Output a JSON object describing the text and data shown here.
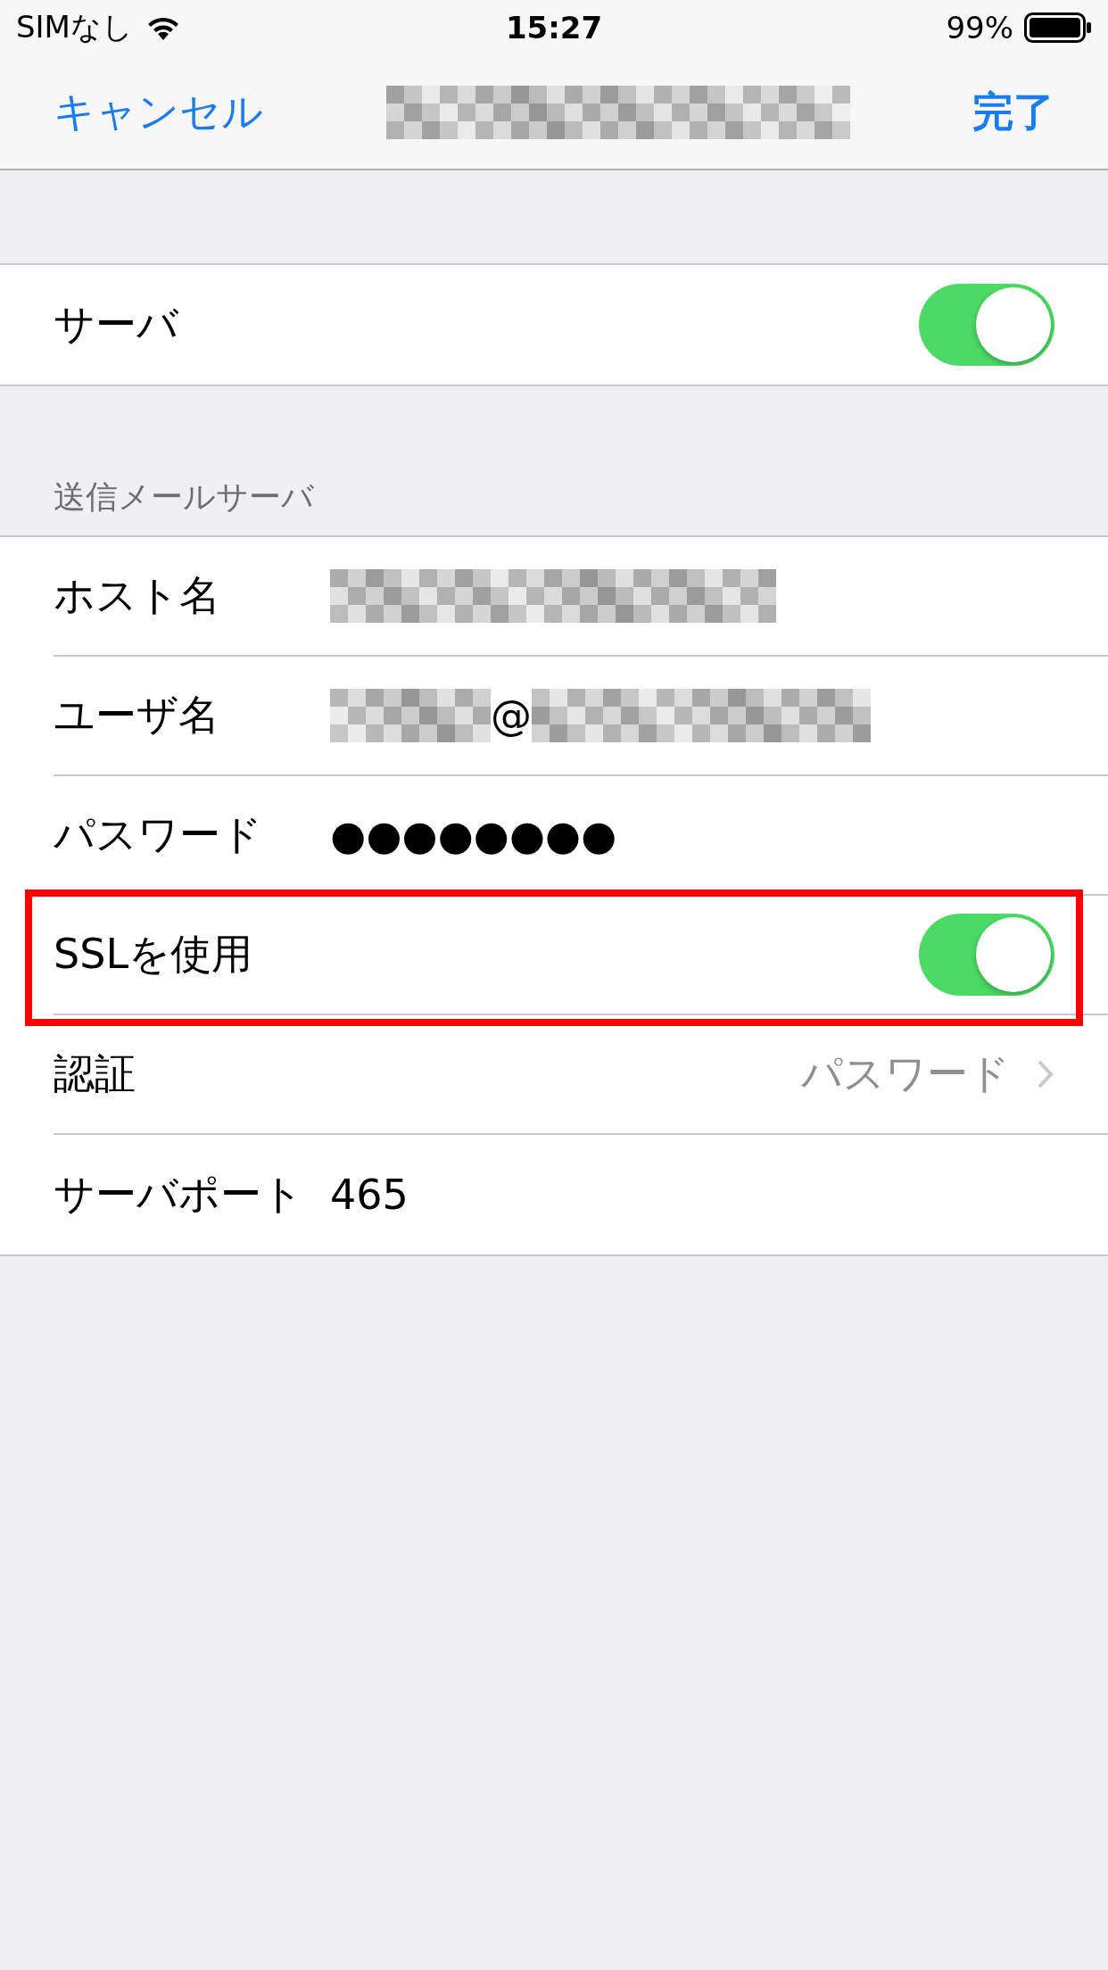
{
  "status_bar": {
    "carrier": "SIMなし",
    "time": "15:27",
    "battery": "99%"
  },
  "nav": {
    "cancel": "キャンセル",
    "title_pixelated": true,
    "done": "完了"
  },
  "server": {
    "label": "サーバ",
    "on": true
  },
  "section": {
    "header": "送信メールサーバ",
    "rows": [
      {
        "kind": "pixelated",
        "label": "ホスト名"
      },
      {
        "kind": "email",
        "label": "ユーザ名",
        "at": "@"
      },
      {
        "kind": "value",
        "label": "パスワード",
        "value": "●●●●●●●●"
      },
      {
        "kind": "toggle",
        "label": "SSLを使用",
        "on": true,
        "highlighted": true
      },
      {
        "kind": "link",
        "label": "認証",
        "value": "パスワード"
      },
      {
        "kind": "value",
        "label": "サーバポート",
        "value": "465"
      }
    ]
  }
}
